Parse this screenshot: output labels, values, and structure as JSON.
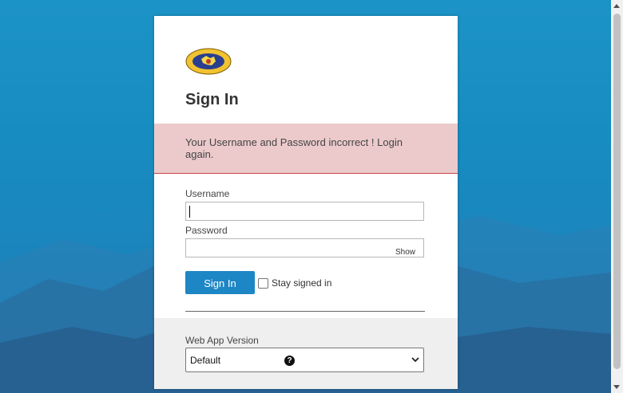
{
  "login": {
    "title": "Sign In",
    "error": "Your Username and Password incorrect ! Login again.",
    "username_label": "Username",
    "username_value": "",
    "password_label": "Password",
    "password_value": "",
    "show_label": "Show",
    "signin_label": "Sign In",
    "stay_signed_in_label": "Stay signed in",
    "stay_signed_in_checked": false
  },
  "footer": {
    "version_label": "Web App Version",
    "version_selected": "Default",
    "help_symbol": "?"
  },
  "colors": {
    "accent": "#1d86c5",
    "error_bg": "#eccacb",
    "error_border": "#c9444f"
  }
}
